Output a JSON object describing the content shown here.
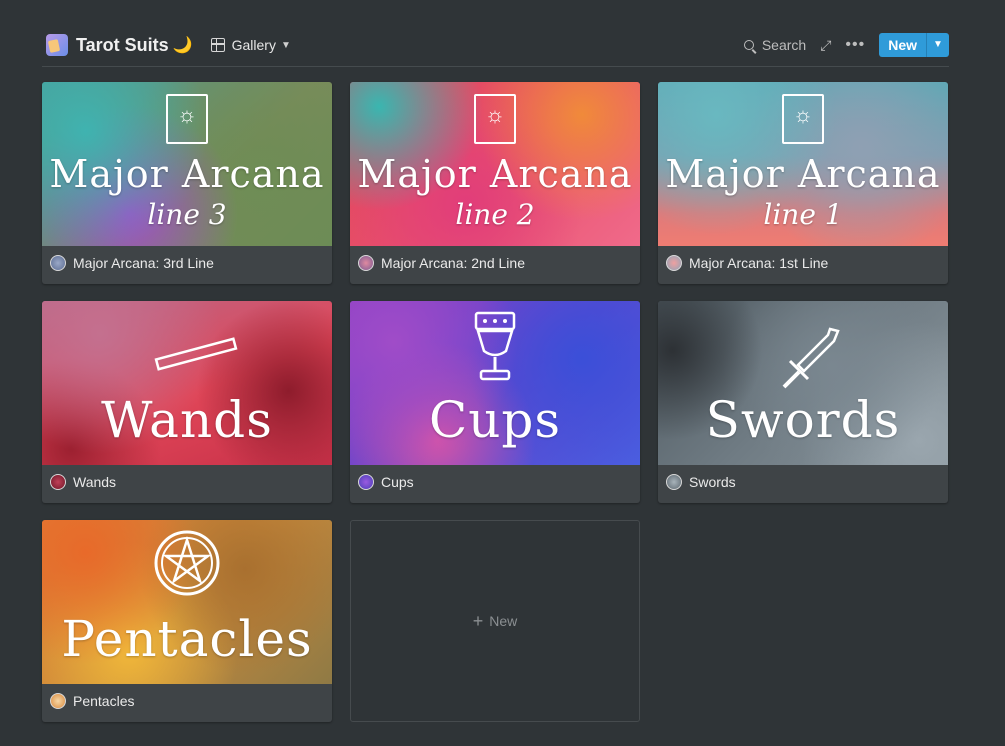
{
  "header": {
    "title": "Tarot Suits",
    "title_emoji": "🌙",
    "view_label": "Gallery",
    "search_label": "Search",
    "new_label": "New"
  },
  "cards": [
    {
      "title": "Major Arcana: 3rd Line",
      "cover_main": "Major Arcana",
      "cover_sub": "line 3"
    },
    {
      "title": "Major Arcana: 2nd Line",
      "cover_main": "Major Arcana",
      "cover_sub": "line 2"
    },
    {
      "title": "Major Arcana: 1st Line",
      "cover_main": "Major Arcana",
      "cover_sub": "line 1"
    },
    {
      "title": "Wands",
      "cover_main": "Wands"
    },
    {
      "title": "Cups",
      "cover_main": "Cups"
    },
    {
      "title": "Swords",
      "cover_main": "Swords"
    },
    {
      "title": "Pentacles",
      "cover_main": "Pentacles"
    }
  ],
  "new_card_label": "New",
  "icons": {
    "database": "tarot-cards-icon",
    "view": "gallery-grid-icon",
    "search": "search-icon",
    "expand": "expand-icon",
    "more": "more-horizontal-icon",
    "dropdown": "chevron-down-icon"
  }
}
